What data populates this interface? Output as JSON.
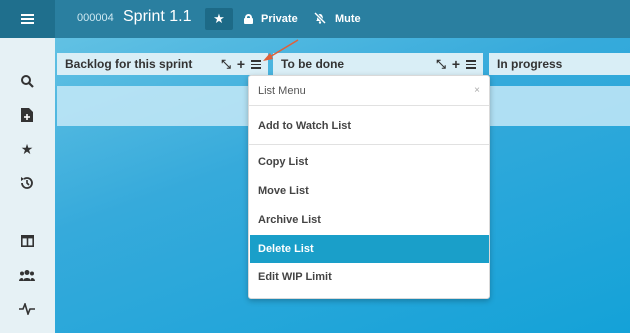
{
  "header": {
    "board_id": "000004",
    "board_title": "Sprint 1.1",
    "privacy_label": "Private",
    "mute_label": "Mute"
  },
  "lists": [
    {
      "title": "Backlog for this sprint"
    },
    {
      "title": "To be done"
    },
    {
      "title": "In progress"
    }
  ],
  "list_menu": {
    "title": "List Menu",
    "close": "×",
    "items": [
      {
        "label": "Add to Watch List"
      },
      {
        "label": "Copy List"
      },
      {
        "label": "Move List"
      },
      {
        "label": "Archive List"
      },
      {
        "label": "Delete List",
        "active": true
      },
      {
        "label": "Edit WIP Limit"
      }
    ]
  },
  "colors": {
    "topbar": "#2a7fa0",
    "active_item": "#1a9fc9",
    "annotation_arrow": "#e0603a"
  }
}
